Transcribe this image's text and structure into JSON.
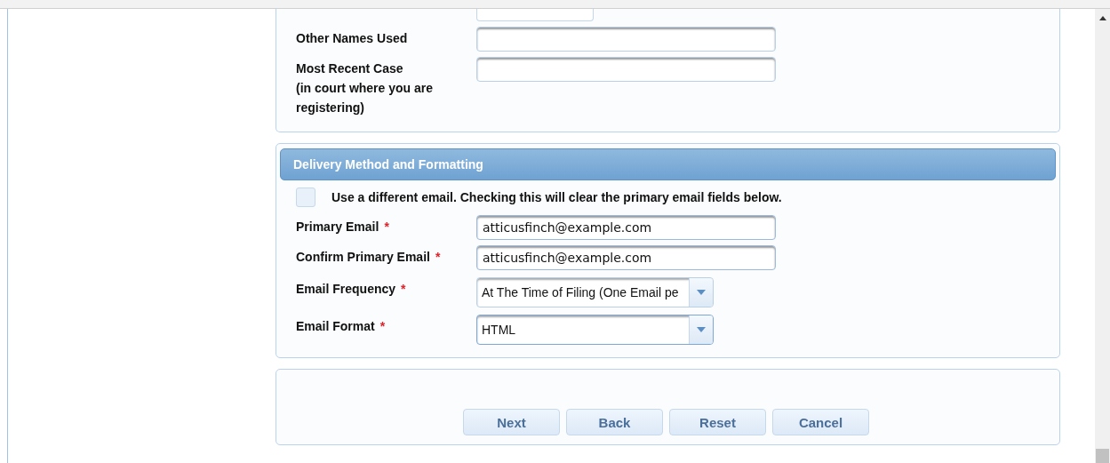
{
  "sections": [
    {
      "fields": [
        {
          "label": "Other Names Used",
          "kind": "text"
        },
        {
          "label": "Most Recent Case",
          "note": "(in court where you are registering)",
          "kind": "text"
        }
      ]
    },
    {
      "title": "Delivery Method and Formatting",
      "checkbox": {
        "label": "Use a different email. Checking this will clear the primary email fields below.",
        "checked": false
      },
      "fields": [
        {
          "label": "Primary Email",
          "kind": "text",
          "required_mark": "*",
          "value": "atticusfinch@example.com"
        },
        {
          "label": "Confirm Primary Email",
          "kind": "text",
          "required_mark": "*",
          "value": "atticusfinch@example.com"
        },
        {
          "label": "Email Frequency",
          "kind": "select",
          "required_mark": "*",
          "value": "At The Time of Filing (One Email pe"
        },
        {
          "label": "Email Format",
          "kind": "select",
          "required_mark": "*",
          "value": "HTML"
        }
      ]
    }
  ],
  "buttons": [
    "Next",
    "Back",
    "Reset",
    "Cancel"
  ]
}
